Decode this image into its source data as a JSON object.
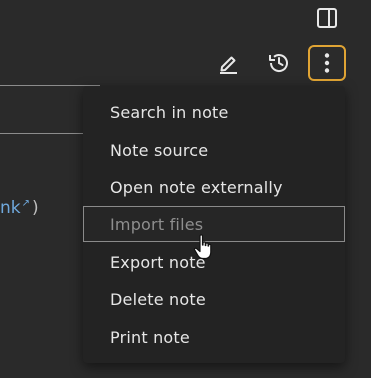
{
  "colors": {
    "background": "#2a2a2a",
    "menu_background": "#232323",
    "menu_text": "#e6e6e6",
    "disabled_text": "#8e8e8e",
    "active_border": "#e0a434",
    "link": "#6fa8dc"
  },
  "icons": {
    "sidebar_toggle": "sidebar-toggle-icon",
    "edit": "pencil-icon",
    "history": "history-icon",
    "more": "vertical-dots-icon",
    "cursor": "hand-pointer-icon"
  },
  "content": {
    "link_fragment": "nk",
    "link_suffix": ")"
  },
  "menu": {
    "items": [
      {
        "label": "Search in note"
      },
      {
        "label": "Note source"
      },
      {
        "label": "Open note externally"
      },
      {
        "label": "Import files"
      },
      {
        "label": "Export note"
      },
      {
        "label": "Delete note"
      },
      {
        "label": "Print note"
      }
    ],
    "hovered_index": 3
  }
}
